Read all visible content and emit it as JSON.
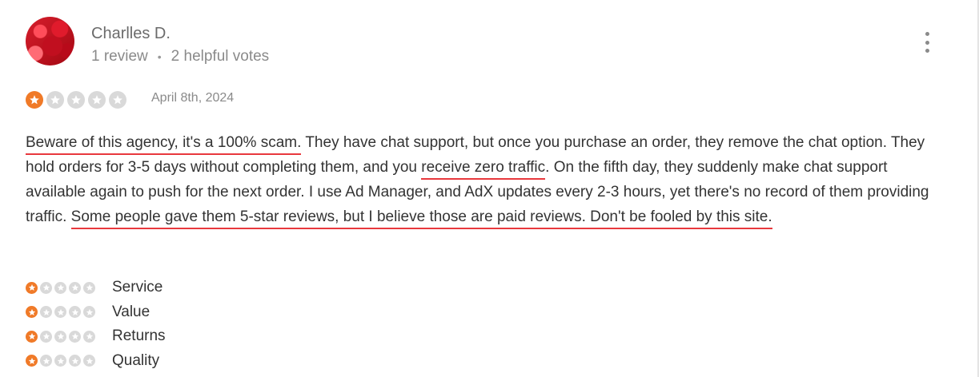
{
  "reviewer": {
    "name": "Charlles D.",
    "reviews": "1 review",
    "separator": "•",
    "helpful_votes": "2 helpful votes"
  },
  "menu_icon": "more-vertical-icon",
  "rating": {
    "score": 1,
    "out_of": 5,
    "date": "April 8th, 2024"
  },
  "review": {
    "segments": [
      {
        "text": "Beware of this agency, it's a 100% scam.",
        "underlined": true
      },
      {
        "text": " They have chat support, but once you purchase an order, they remove the chat option. They hold orders for 3-5 days without completing them, and you ",
        "underlined": false
      },
      {
        "text": "receive zero traffic",
        "underlined": true
      },
      {
        "text": ". On the fifth day, they suddenly make chat support available again to push for the next order. I use Ad Manager, and AdX updates every 2-3 hours, yet there's no record of them providing traffic. ",
        "underlined": false
      },
      {
        "text": "Some people gave them 5-star reviews, but I believe those are paid reviews. Don't be fooled by this site.",
        "underlined": true
      }
    ]
  },
  "sub_ratings": [
    {
      "label": "Service",
      "score": 1
    },
    {
      "label": "Value",
      "score": 1
    },
    {
      "label": "Returns",
      "score": 1
    },
    {
      "label": "Quality",
      "score": 1
    }
  ],
  "colors": {
    "star_active": "#f07a28",
    "star_inactive": "#d9d9d9",
    "underline": "#e8383d"
  }
}
